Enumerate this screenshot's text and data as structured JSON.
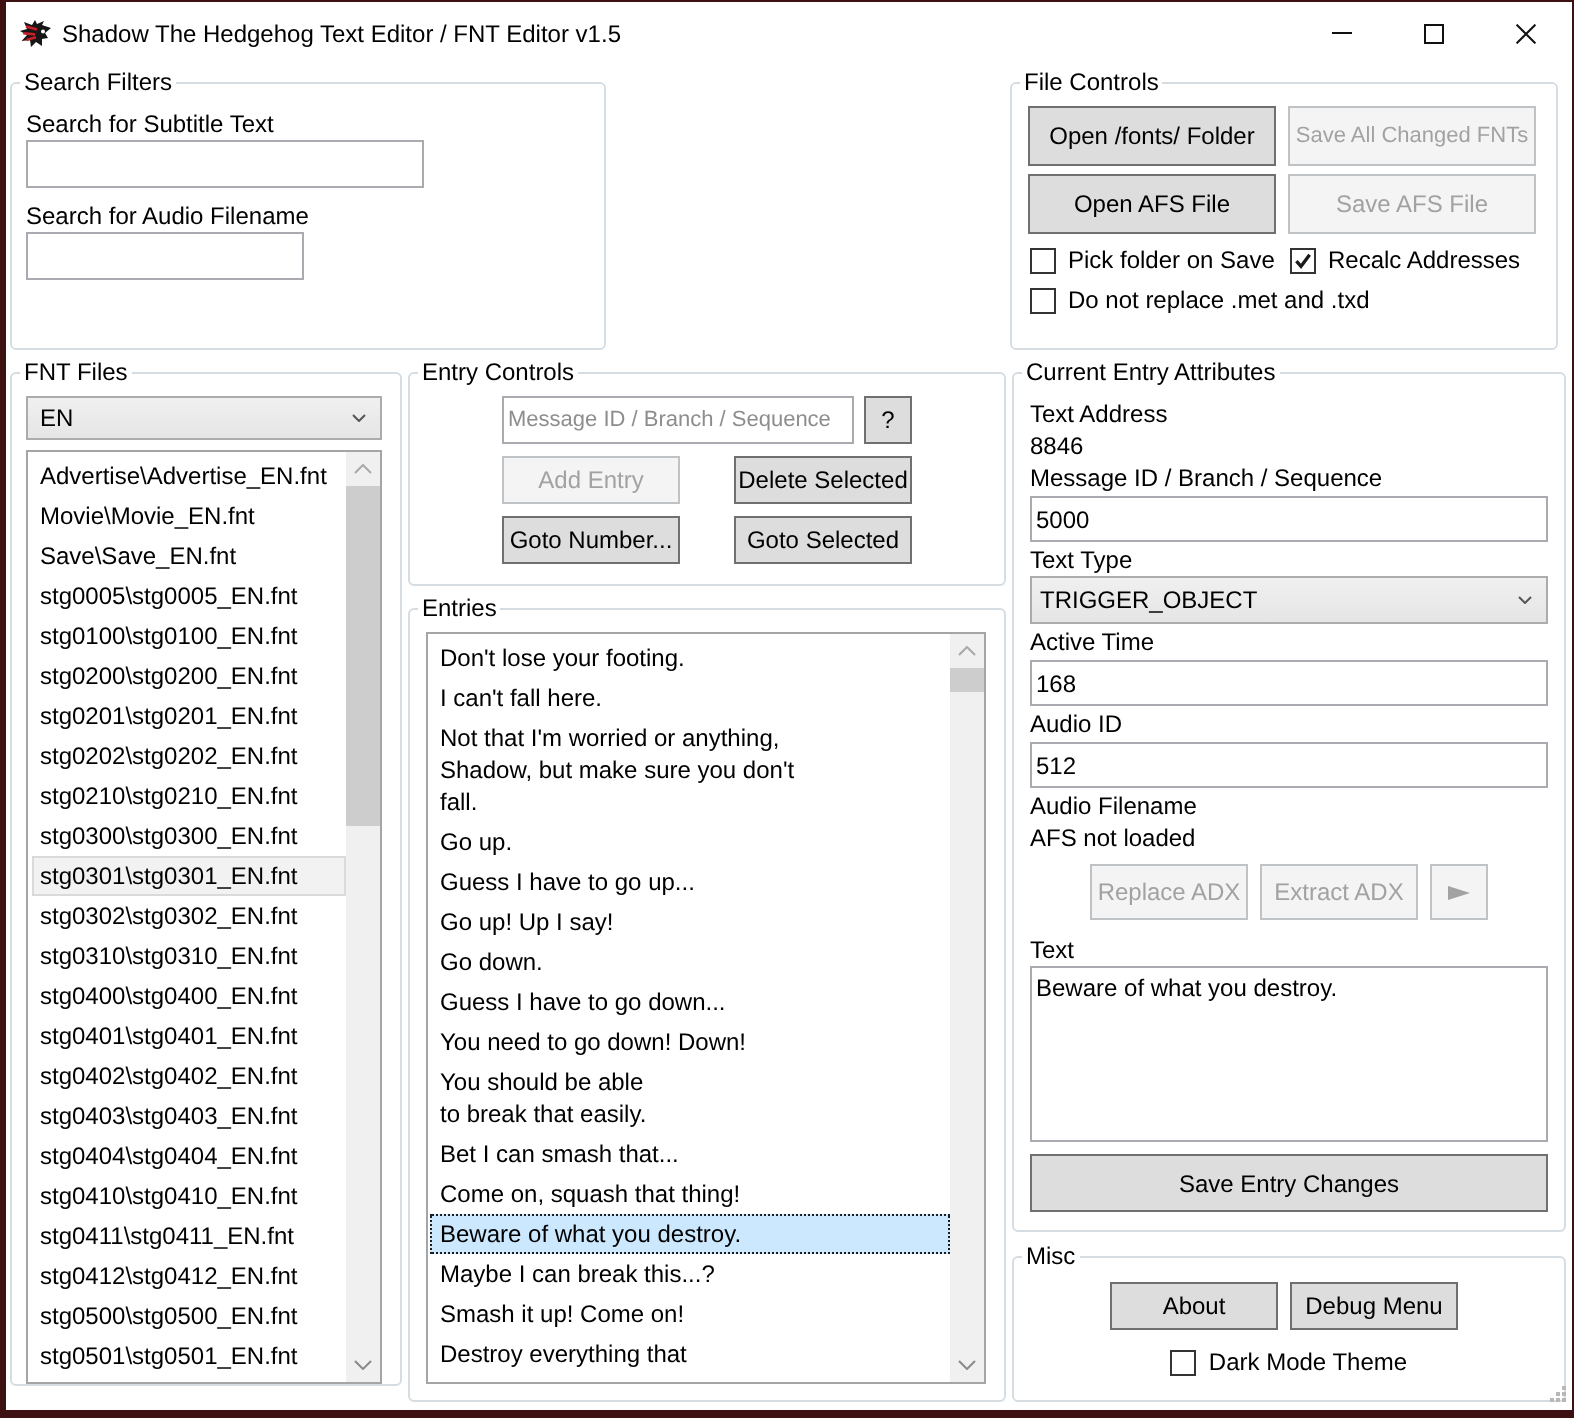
{
  "window": {
    "title": "Shadow The Hedgehog Text Editor / FNT Editor v1.5"
  },
  "search_filters": {
    "title": "Search Filters",
    "fields": [
      {
        "label": "Search for Subtitle Text"
      },
      {
        "label": "Search for Audio Filename"
      }
    ]
  },
  "file_controls": {
    "title": "File Controls",
    "buttons": [
      {
        "label": "Open /fonts/ Folder",
        "disabled": false
      },
      {
        "label": "Save All Changed FNTs",
        "disabled": true
      },
      {
        "label": "Open AFS File",
        "disabled": false
      },
      {
        "label": "Save AFS File",
        "disabled": true
      }
    ],
    "options": [
      {
        "label": "Pick folder on Save",
        "checked": false
      },
      {
        "label": "Recalc Addresses",
        "checked": true
      },
      {
        "label": "Do not replace .met and .txd",
        "checked": false
      }
    ]
  },
  "fnt_files": {
    "title": "FNT Files",
    "language": "EN",
    "files": [
      {
        "name": "Advertise\\Advertise_EN.fnt",
        "selected": false
      },
      {
        "name": "Movie\\Movie_EN.fnt",
        "selected": false
      },
      {
        "name": "Save\\Save_EN.fnt",
        "selected": false
      },
      {
        "name": "stg0005\\stg0005_EN.fnt",
        "selected": false
      },
      {
        "name": "stg0100\\stg0100_EN.fnt",
        "selected": false
      },
      {
        "name": "stg0200\\stg0200_EN.fnt",
        "selected": false
      },
      {
        "name": "stg0201\\stg0201_EN.fnt",
        "selected": false
      },
      {
        "name": "stg0202\\stg0202_EN.fnt",
        "selected": false
      },
      {
        "name": "stg0210\\stg0210_EN.fnt",
        "selected": false
      },
      {
        "name": "stg0300\\stg0300_EN.fnt",
        "selected": false
      },
      {
        "name": "stg0301\\stg0301_EN.fnt",
        "selected": true
      },
      {
        "name": "stg0302\\stg0302_EN.fnt",
        "selected": false
      },
      {
        "name": "stg0310\\stg0310_EN.fnt",
        "selected": false
      },
      {
        "name": "stg0400\\stg0400_EN.fnt",
        "selected": false
      },
      {
        "name": "stg0401\\stg0401_EN.fnt",
        "selected": false
      },
      {
        "name": "stg0402\\stg0402_EN.fnt",
        "selected": false
      },
      {
        "name": "stg0403\\stg0403_EN.fnt",
        "selected": false
      },
      {
        "name": "stg0404\\stg0404_EN.fnt",
        "selected": false
      },
      {
        "name": "stg0410\\stg0410_EN.fnt",
        "selected": false
      },
      {
        "name": "stg0411\\stg0411_EN.fnt",
        "selected": false
      },
      {
        "name": "stg0412\\stg0412_EN.fnt",
        "selected": false
      },
      {
        "name": "stg0500\\stg0500_EN.fnt",
        "selected": false
      },
      {
        "name": "stg0501\\stg0501_EN.fnt",
        "selected": false
      }
    ]
  },
  "entry_controls": {
    "title": "Entry Controls",
    "id_field": {
      "placeholder": "Message ID / Branch / Sequence"
    },
    "help_button": "?",
    "buttons": [
      {
        "label": "Add Entry",
        "disabled": true
      },
      {
        "label": "Delete Selected",
        "disabled": false
      },
      {
        "label": "Goto Number...",
        "disabled": false
      },
      {
        "label": "Goto Selected",
        "disabled": false
      }
    ]
  },
  "entries": {
    "title": "Entries",
    "items": [
      {
        "text": "Don't lose your footing.",
        "selected": false
      },
      {
        "text": "I can't fall here.",
        "selected": false
      },
      {
        "text": "Not that I'm worried or anything,\nShadow, but make sure you don't\nfall.",
        "selected": false
      },
      {
        "text": "Go up.",
        "selected": false
      },
      {
        "text": "Guess I have to go up...",
        "selected": false
      },
      {
        "text": "Go up! Up I say!",
        "selected": false
      },
      {
        "text": "Go down.",
        "selected": false
      },
      {
        "text": "Guess I have to go down...",
        "selected": false
      },
      {
        "text": "You need to go down! Down!",
        "selected": false
      },
      {
        "text": "You should be able\nto break that easily.",
        "selected": false
      },
      {
        "text": "Bet I can smash that...",
        "selected": false
      },
      {
        "text": "Come on, squash that thing!",
        "selected": false
      },
      {
        "text": "Beware of what you destroy.",
        "selected": true
      },
      {
        "text": "Maybe I can break this...?",
        "selected": false
      },
      {
        "text": "Smash it up! Come on!",
        "selected": false
      },
      {
        "text": "Destroy everything that",
        "selected": false
      }
    ]
  },
  "current_entry": {
    "title": "Current Entry Attributes",
    "fields": [
      {
        "kind": "readout",
        "label": "Text Address",
        "value": "8846"
      },
      {
        "kind": "input",
        "label": "Message ID / Branch / Sequence",
        "value": "5000"
      },
      {
        "kind": "dropdown",
        "label": "Text Type",
        "value": "TRIGGER_OBJECT"
      },
      {
        "kind": "input",
        "label": "Active Time",
        "value": "168"
      },
      {
        "kind": "input",
        "label": "Audio ID",
        "value": "512"
      },
      {
        "kind": "readout",
        "label": "Audio Filename",
        "value": "AFS not loaded"
      }
    ],
    "audio_buttons": [
      {
        "kind": "text",
        "label": "Replace ADX",
        "disabled": true
      },
      {
        "kind": "text",
        "label": "Extract ADX",
        "disabled": true
      },
      {
        "kind": "play",
        "disabled": true
      }
    ],
    "text": {
      "label": "Text",
      "value": "Beware of what you destroy."
    },
    "save_button": "Save Entry Changes"
  },
  "misc": {
    "title": "Misc",
    "buttons": [
      "About",
      "Debug Menu"
    ],
    "dark_mode": {
      "label": "Dark Mode Theme",
      "checked": false
    }
  }
}
